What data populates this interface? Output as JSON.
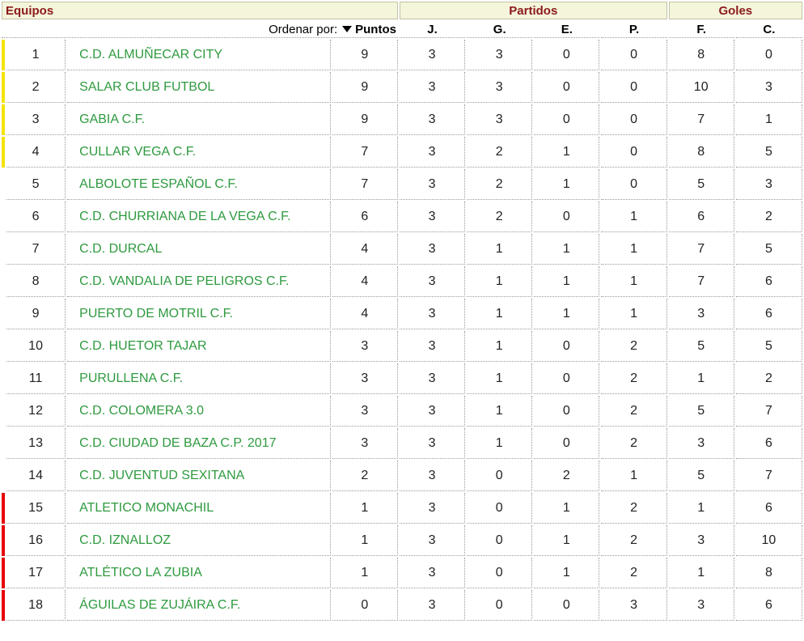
{
  "header": {
    "equipos": "Equipos",
    "partidos": "Partidos",
    "goles": "Goles",
    "order_label": "Ordenar por:",
    "sort_key": "Puntos",
    "cols": {
      "j": "J.",
      "g": "G.",
      "e": "E.",
      "p": "P.",
      "f": "F.",
      "c": "C."
    }
  },
  "colors": {
    "promotion_zone": "#f4e300",
    "relegation_zone": "#e60000",
    "team_link": "#2e9a3f",
    "group_heading": "#8b1a1a",
    "header_bg": "#f5f5dc"
  },
  "teams": [
    {
      "pos": "1",
      "name": "C.D. ALMUÑECAR CITY",
      "pts": "9",
      "j": "3",
      "g": "3",
      "e": "0",
      "p": "0",
      "f": "8",
      "c": "0",
      "zone": "promo"
    },
    {
      "pos": "2",
      "name": "SALAR CLUB FUTBOL",
      "pts": "9",
      "j": "3",
      "g": "3",
      "e": "0",
      "p": "0",
      "f": "10",
      "c": "3",
      "zone": "promo"
    },
    {
      "pos": "3",
      "name": "GABIA C.F.",
      "pts": "9",
      "j": "3",
      "g": "3",
      "e": "0",
      "p": "0",
      "f": "7",
      "c": "1",
      "zone": "promo"
    },
    {
      "pos": "4",
      "name": "CULLAR VEGA C.F.",
      "pts": "7",
      "j": "3",
      "g": "2",
      "e": "1",
      "p": "0",
      "f": "8",
      "c": "5",
      "zone": "promo"
    },
    {
      "pos": "5",
      "name": "ALBOLOTE ESPAÑOL C.F.",
      "pts": "7",
      "j": "3",
      "g": "2",
      "e": "1",
      "p": "0",
      "f": "5",
      "c": "3",
      "zone": "none"
    },
    {
      "pos": "6",
      "name": "C.D. CHURRIANA DE LA VEGA C.F.",
      "pts": "6",
      "j": "3",
      "g": "2",
      "e": "0",
      "p": "1",
      "f": "6",
      "c": "2",
      "zone": "none"
    },
    {
      "pos": "7",
      "name": "C.D. DURCAL",
      "pts": "4",
      "j": "3",
      "g": "1",
      "e": "1",
      "p": "1",
      "f": "7",
      "c": "5",
      "zone": "none"
    },
    {
      "pos": "8",
      "name": "C.D. VANDALIA DE PELIGROS C.F.",
      "pts": "4",
      "j": "3",
      "g": "1",
      "e": "1",
      "p": "1",
      "f": "7",
      "c": "6",
      "zone": "none"
    },
    {
      "pos": "9",
      "name": "PUERTO DE MOTRIL C.F.",
      "pts": "4",
      "j": "3",
      "g": "1",
      "e": "1",
      "p": "1",
      "f": "3",
      "c": "6",
      "zone": "none"
    },
    {
      "pos": "10",
      "name": "C.D. HUETOR TAJAR",
      "pts": "3",
      "j": "3",
      "g": "1",
      "e": "0",
      "p": "2",
      "f": "5",
      "c": "5",
      "zone": "none"
    },
    {
      "pos": "11",
      "name": "PURULLENA C.F.",
      "pts": "3",
      "j": "3",
      "g": "1",
      "e": "0",
      "p": "2",
      "f": "1",
      "c": "2",
      "zone": "none"
    },
    {
      "pos": "12",
      "name": "C.D. COLOMERA 3.0",
      "pts": "3",
      "j": "3",
      "g": "1",
      "e": "0",
      "p": "2",
      "f": "5",
      "c": "7",
      "zone": "none"
    },
    {
      "pos": "13",
      "name": "C.D. CIUDAD DE BAZA C.P. 2017",
      "pts": "3",
      "j": "3",
      "g": "1",
      "e": "0",
      "p": "2",
      "f": "3",
      "c": "6",
      "zone": "none"
    },
    {
      "pos": "14",
      "name": "C.D. JUVENTUD SEXITANA",
      "pts": "2",
      "j": "3",
      "g": "0",
      "e": "2",
      "p": "1",
      "f": "5",
      "c": "7",
      "zone": "none"
    },
    {
      "pos": "15",
      "name": "ATLETICO MONACHIL",
      "pts": "1",
      "j": "3",
      "g": "0",
      "e": "1",
      "p": "2",
      "f": "1",
      "c": "6",
      "zone": "releg"
    },
    {
      "pos": "16",
      "name": "C.D. IZNALLOZ",
      "pts": "1",
      "j": "3",
      "g": "0",
      "e": "1",
      "p": "2",
      "f": "3",
      "c": "10",
      "zone": "releg"
    },
    {
      "pos": "17",
      "name": "ATLÉTICO LA ZUBIA",
      "pts": "1",
      "j": "3",
      "g": "0",
      "e": "1",
      "p": "2",
      "f": "1",
      "c": "8",
      "zone": "releg"
    },
    {
      "pos": "18",
      "name": "ÁGUILAS DE ZUJÁIRA C.F.",
      "pts": "0",
      "j": "3",
      "g": "0",
      "e": "0",
      "p": "3",
      "f": "3",
      "c": "6",
      "zone": "releg"
    }
  ]
}
